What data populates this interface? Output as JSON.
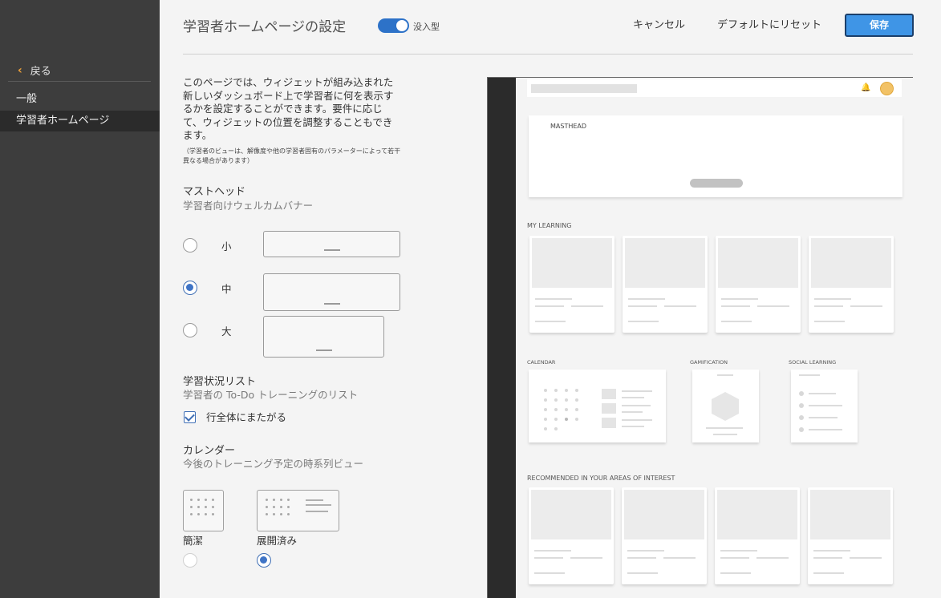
{
  "sidebar": {
    "back_label": "戻る",
    "items": [
      {
        "label": "一般"
      },
      {
        "label": "学習者ホームページ"
      }
    ]
  },
  "header": {
    "title": "学習者ホームページの設定",
    "toggle_label": "没入型",
    "cancel_label": "キャンセル",
    "reset_label": "デフォルトにリセット",
    "save_label": "保存"
  },
  "content": {
    "description": "このページでは、ウィジェットが組み込まれた新しいダッシュボード上で学習者に何を表示するかを設定することができます。要件に応じて、ウィジェットの位置を調整することもできます。",
    "note": "（学習者のビューは、解像度や他の学習者固有のパラメーターによって若干異なる場合があります）",
    "masthead": {
      "title": "マストヘッド",
      "subtitle": "学習者向けウェルカムバナー",
      "options": [
        {
          "label": "小",
          "selected": false
        },
        {
          "label": "中",
          "selected": true
        },
        {
          "label": "大",
          "selected": false
        }
      ]
    },
    "learning_status": {
      "title": "学習状況リスト",
      "subtitle": "学習者の To-Do トレーニングのリスト",
      "checkbox_label": "行全体にまたがる",
      "checked": true
    },
    "calendar": {
      "title": "カレンダー",
      "subtitle": "今後のトレーニング予定の時系列ビュー",
      "options": [
        {
          "label": "簡潔",
          "selected": false
        },
        {
          "label": "展開済み",
          "selected": true
        }
      ]
    }
  },
  "preview": {
    "masthead_label": "MASTHEAD",
    "my_learning_label": "MY LEARNING",
    "calendar_label": "CALENDAR",
    "gamification_label": "GAMIFICATION",
    "social_learning_label": "SOCIAL LEARNING",
    "recommended_label": "RECOMMENDED IN YOUR AREAS OF INTEREST"
  },
  "colors": {
    "accent": "#2d72c8",
    "save_button": "#3f95e6",
    "sidebar_bg": "#3d3d3d",
    "back_chevron": "#f0a23a"
  }
}
